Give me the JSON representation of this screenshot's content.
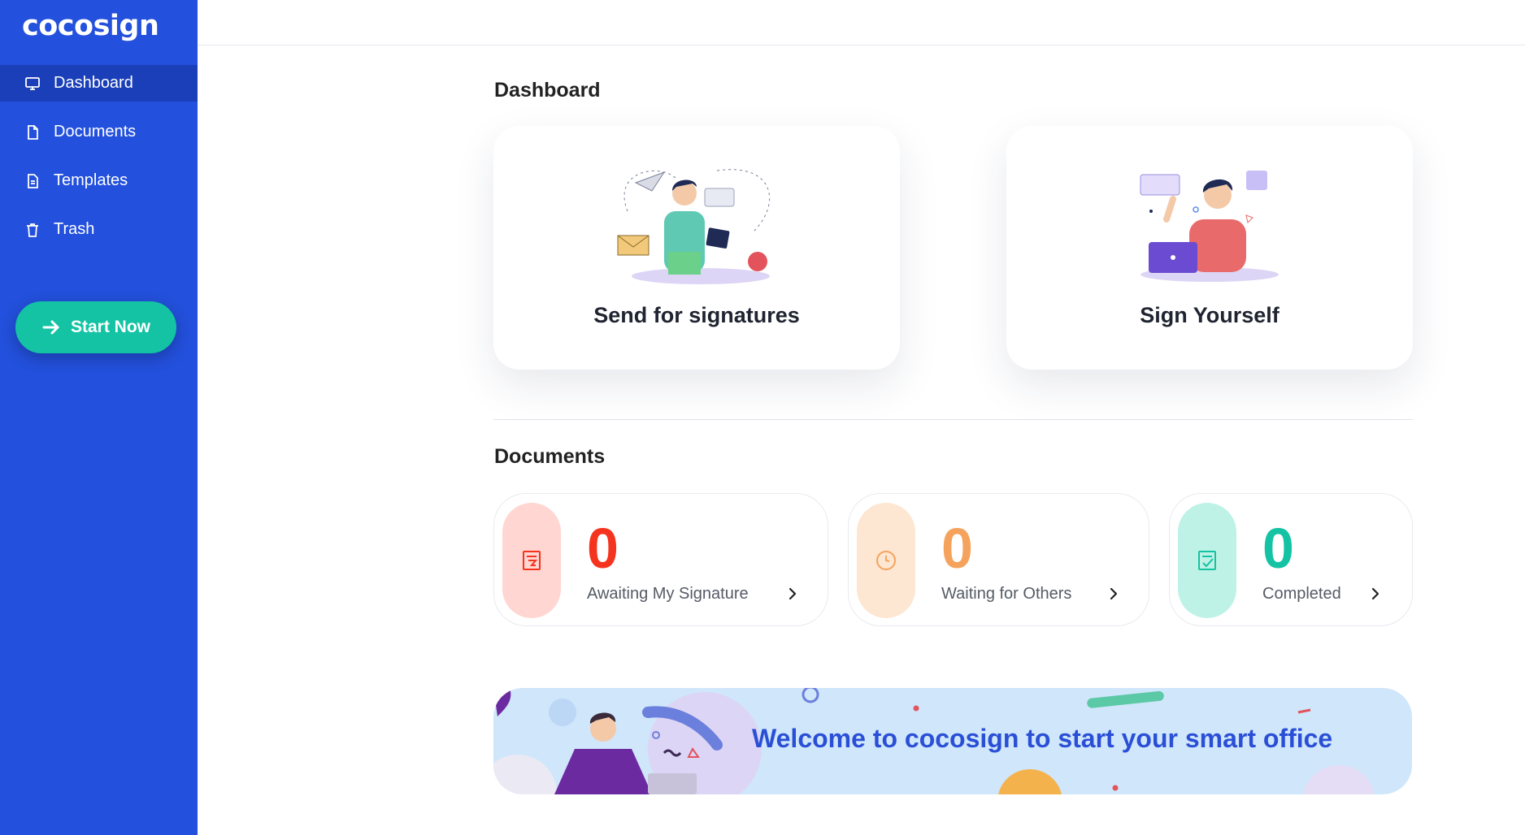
{
  "brand": {
    "logo_text": "cocosign"
  },
  "sidebar": {
    "items": [
      {
        "label": "Dashboard",
        "icon": "monitor-icon",
        "active": true
      },
      {
        "label": "Documents",
        "icon": "document-icon",
        "active": false
      },
      {
        "label": "Templates",
        "icon": "template-icon",
        "active": false
      },
      {
        "label": "Trash",
        "icon": "trash-icon",
        "active": false
      }
    ],
    "start_button": "Start Now"
  },
  "dashboard": {
    "title": "Dashboard",
    "cards": [
      {
        "label": "Send for signatures"
      },
      {
        "label": "Sign Yourself"
      }
    ]
  },
  "documents": {
    "title": "Documents",
    "stats": [
      {
        "count": "0",
        "label": "Awaiting My Signature",
        "color": "#f5341f",
        "pill_color": "#ffd6d1",
        "icon": "signature-doc-icon"
      },
      {
        "count": "0",
        "label": "Waiting for Others",
        "color": "#f5a35c",
        "pill_color": "#fde6d2",
        "icon": "clock-icon"
      },
      {
        "count": "0",
        "label": "Completed",
        "color": "#14c3a4",
        "pill_color": "#bff2e6",
        "icon": "checked-doc-icon"
      }
    ]
  },
  "banner": {
    "text": "Welcome to cocosign to start your smart office"
  },
  "colors": {
    "sidebar": "#2350dc",
    "sidebar_active": "#1a3fb8",
    "accent_green": "#14c3a4",
    "banner_bg": "#cfe6fb",
    "banner_text": "#2a4fd6"
  }
}
